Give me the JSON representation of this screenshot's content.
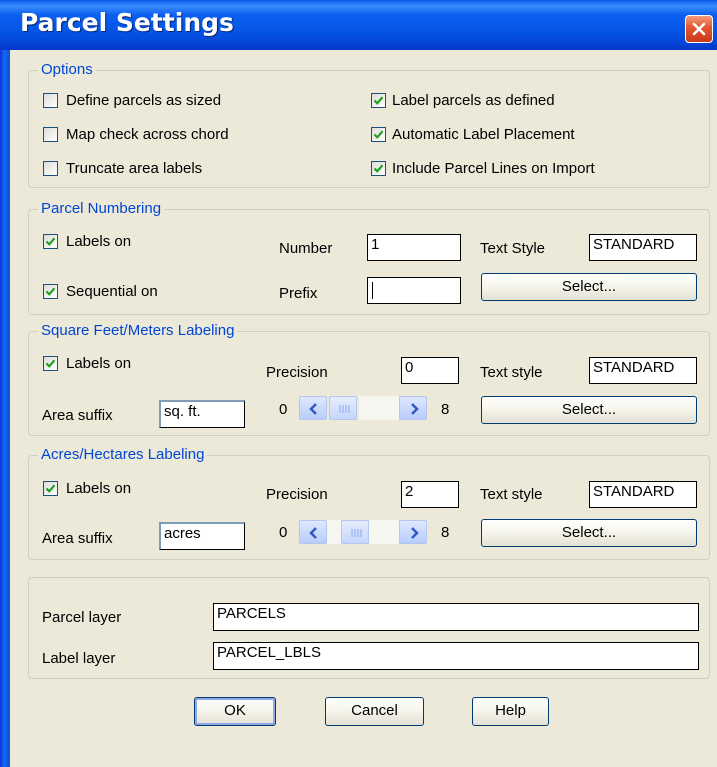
{
  "window": {
    "title": "Parcel Settings"
  },
  "options": {
    "title": "Options",
    "items": [
      {
        "label": "Define parcels as sized",
        "checked": false
      },
      {
        "label": "Map check across chord",
        "checked": false
      },
      {
        "label": "Truncate area labels",
        "checked": false
      },
      {
        "label": "Label parcels as defined",
        "checked": true
      },
      {
        "label": "Automatic Label Placement",
        "checked": true
      },
      {
        "label": "Include Parcel Lines on Import",
        "checked": true
      }
    ]
  },
  "parcel_numbering": {
    "title": "Parcel Numbering",
    "labels_on": {
      "label": "Labels on",
      "checked": true
    },
    "sequential_on": {
      "label": "Sequential on",
      "checked": true
    },
    "number_label": "Number",
    "number_value": "1",
    "prefix_label": "Prefix",
    "prefix_value": "",
    "text_style_label": "Text Style",
    "text_style_value": "STANDARD",
    "select_label": "Select..."
  },
  "sqft_labeling": {
    "title": "Square Feet/Meters Labeling",
    "labels_on": {
      "label": "Labels on",
      "checked": true
    },
    "precision_label": "Precision",
    "precision_value": "0",
    "text_style_label": "Text style",
    "text_style_value": "STANDARD",
    "area_suffix_label": "Area suffix",
    "area_suffix_value": "sq. ft.",
    "range_min": "0",
    "range_max": "8",
    "select_label": "Select..."
  },
  "acres_labeling": {
    "title": "Acres/Hectares Labeling",
    "labels_on": {
      "label": "Labels on",
      "checked": true
    },
    "precision_label": "Precision",
    "precision_value": "2",
    "text_style_label": "Text style",
    "text_style_value": "STANDARD",
    "area_suffix_label": "Area suffix",
    "area_suffix_value": "acres",
    "range_min": "0",
    "range_max": "8",
    "select_label": "Select..."
  },
  "layers": {
    "parcel_layer_label": "Parcel layer",
    "parcel_layer_value": "PARCELS",
    "label_layer_label": "Label layer",
    "label_layer_value": "PARCEL_LBLS"
  },
  "buttons": {
    "ok": "OK",
    "cancel": "Cancel",
    "help": "Help"
  },
  "colors": {
    "titlebar": "#0655e6",
    "group_title": "#0046d5",
    "checkmark": "#21a121",
    "dialog_bg": "#ece9d8"
  }
}
